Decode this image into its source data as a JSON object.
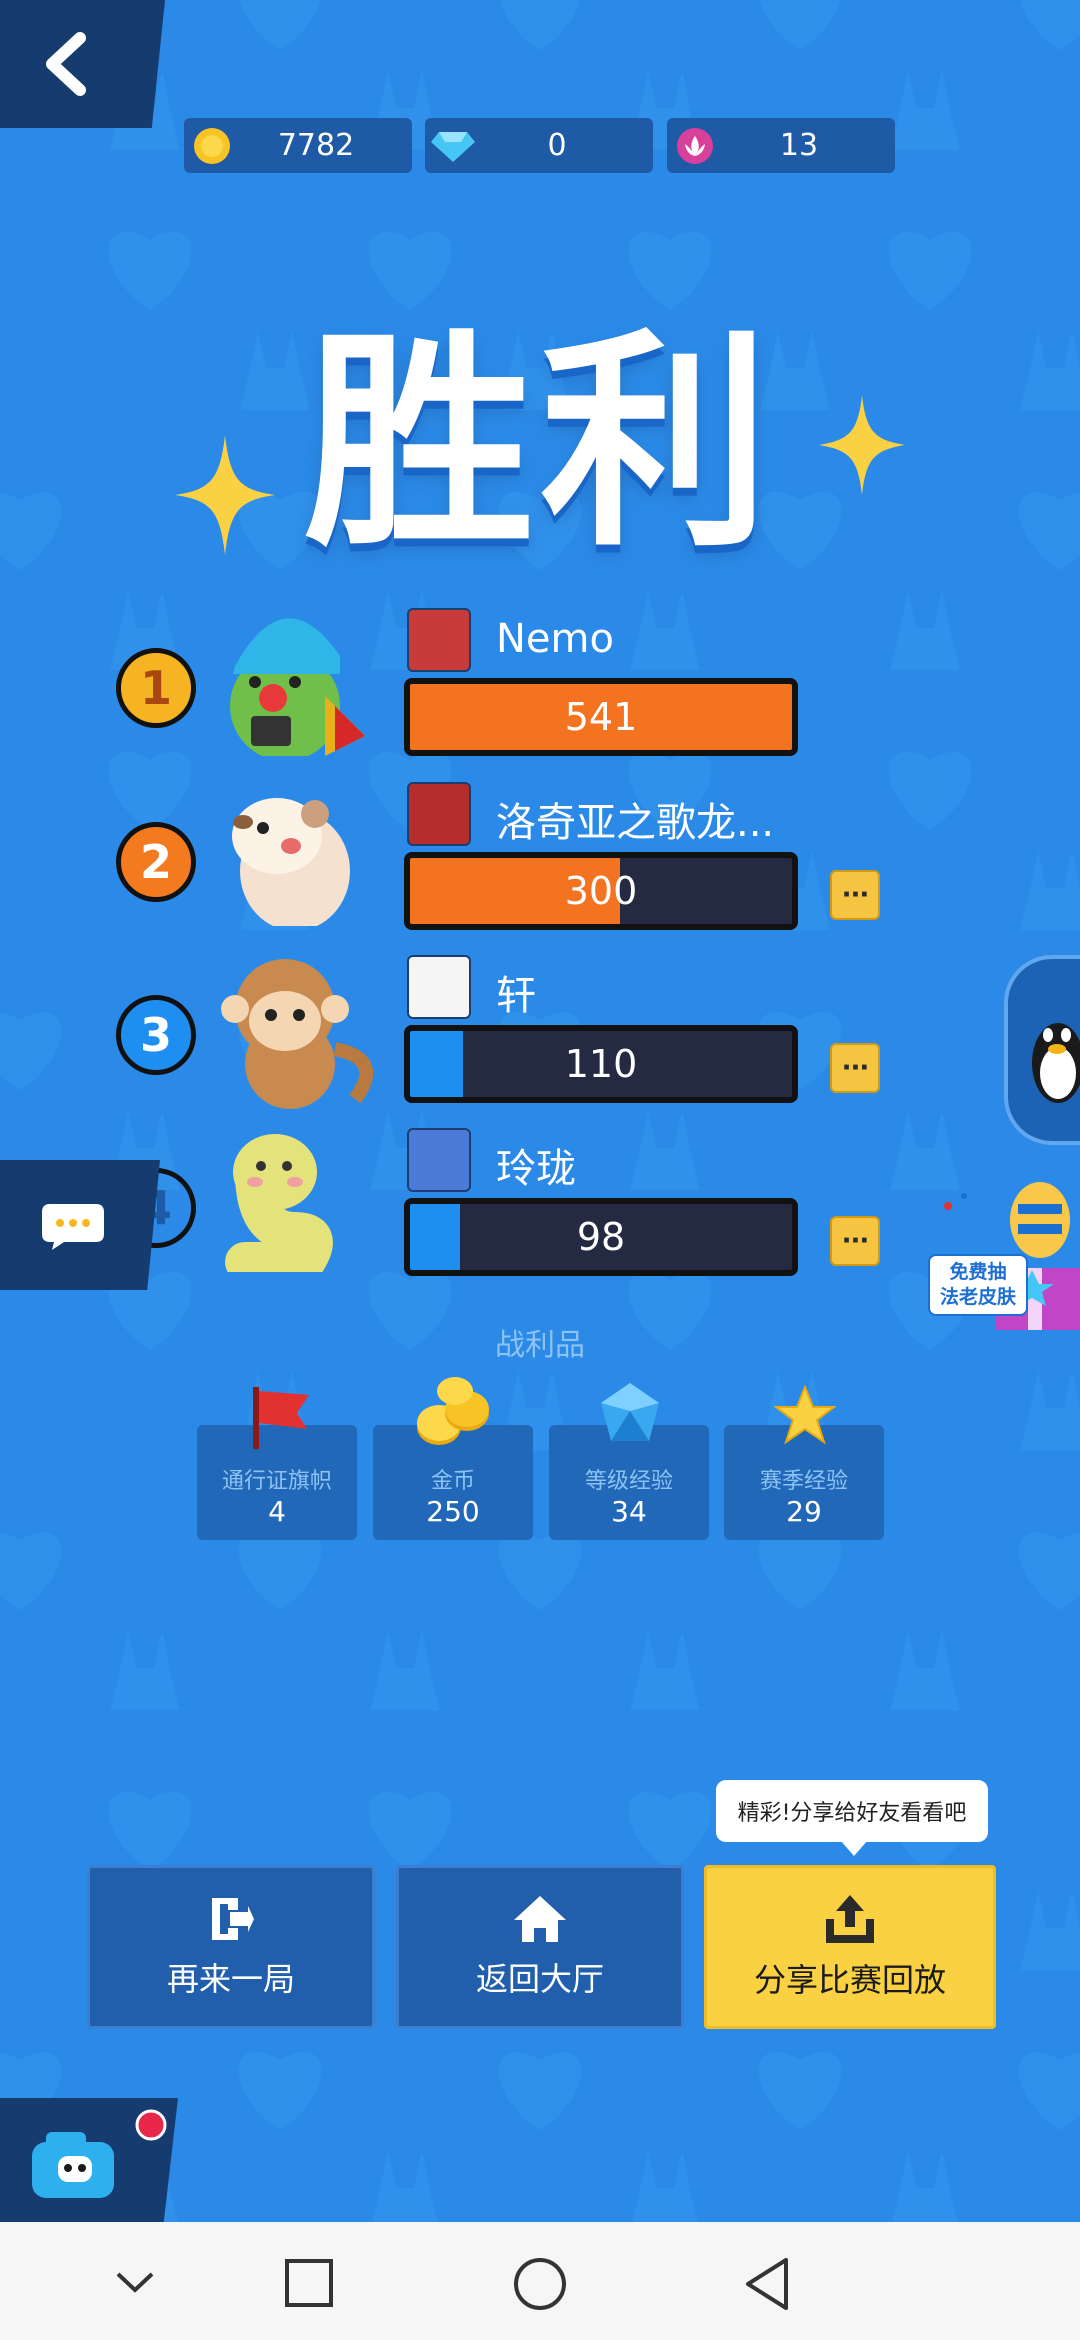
{
  "currencies": [
    {
      "icon": "gold-coin-icon",
      "value": "7782"
    },
    {
      "icon": "diamond-icon",
      "value": "0"
    },
    {
      "icon": "lotus-token-icon",
      "value": "13"
    }
  ],
  "title": "胜利",
  "players": [
    {
      "rank": "1",
      "name": "Nemo",
      "score": "541",
      "score_fraction": 1.0,
      "fill_color": "#f47320",
      "avatar": "green-cactus-avatar",
      "show_more": false
    },
    {
      "rank": "2",
      "name": "洛奇亚之歌龙...",
      "score": "300",
      "score_fraction": 0.55,
      "fill_color": "#f47320",
      "avatar": "hamster-avatar",
      "show_more": true
    },
    {
      "rank": "3",
      "name": "轩",
      "score": "110",
      "score_fraction": 0.14,
      "fill_color": "#1e8ff0",
      "avatar": "monkey-avatar",
      "show_more": true
    },
    {
      "rank": "4",
      "name": "玲珑",
      "score": "98",
      "score_fraction": 0.13,
      "fill_color": "#1e8ff0",
      "avatar": "snake-avatar",
      "show_more": true
    }
  ],
  "more_button_label": "···",
  "loot": {
    "title": "战利品",
    "items": [
      {
        "label": "通行证旗帜",
        "value": "4",
        "icon": "red-flag-icon"
      },
      {
        "label": "金币",
        "value": "250",
        "icon": "gold-coins-icon"
      },
      {
        "label": "等级经验",
        "value": "34",
        "icon": "blue-crystal-icon"
      },
      {
        "label": "赛季经验",
        "value": "29",
        "icon": "gold-star-icon"
      }
    ]
  },
  "actions": {
    "play_again": "再来一局",
    "return_lobby": "返回大厅",
    "share_replay": "分享比赛回放",
    "share_tooltip": "精彩!分享给好友看看吧"
  },
  "promo": {
    "line1": "免费抽",
    "line2": "法老皮肤"
  },
  "colors": {
    "background": "#2b8ae8",
    "panel": "#163b6e",
    "accent_yellow": "#f9d143",
    "bar_orange": "#f47320",
    "bar_blue": "#1e8ff0"
  }
}
